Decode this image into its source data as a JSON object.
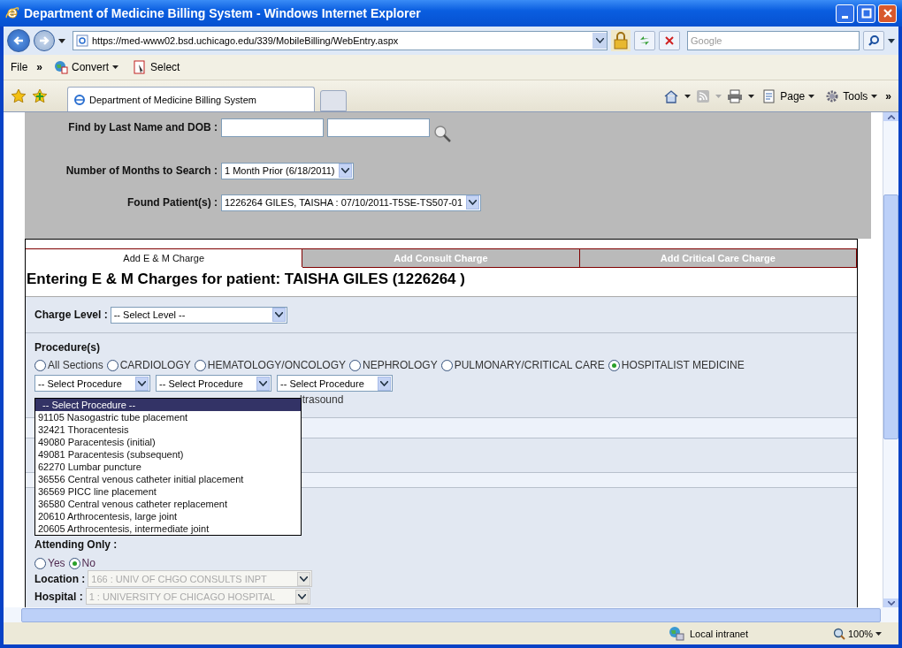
{
  "window": {
    "title": "Department of Medicine Billing System - Windows Internet Explorer"
  },
  "address_bar": {
    "url": "https://med-www02.bsd.uchicago.edu/339/MobileBilling/WebEntry.aspx",
    "search_placeholder": "Google"
  },
  "menu_bar": {
    "items": [
      "File"
    ],
    "overflow": "»",
    "commands": [
      {
        "label": "Convert",
        "kind": "convert"
      },
      {
        "label": "Select",
        "kind": "select"
      }
    ]
  },
  "tab_bar": {
    "tabs": [
      {
        "title": "Department of Medicine Billing System",
        "selected": true
      }
    ],
    "commands": [
      {
        "label": "Page",
        "kind": "page"
      },
      {
        "label": "Tools",
        "kind": "tools"
      }
    ]
  },
  "search_panel": {
    "find_label": "Find by Last Name and DOB :",
    "months_label": "Number of Months to Search :",
    "months_value": "1 Month Prior (6/18/2011)",
    "patient_label": "Found Patient(s) :",
    "patient_value": "1226264 GILES, TAISHA : 07/10/2011-T5SE-TS507-01"
  },
  "charge_tabs": [
    {
      "label": "Add E & M Charge",
      "selected": true
    },
    {
      "label": "Add Consult Charge",
      "selected": false
    },
    {
      "label": "Add Critical Care Charge",
      "selected": false
    }
  ],
  "heading": "Entering E & M Charges for patient: TAISHA GILES (1226264 )",
  "charge_level": {
    "label": "Charge Level :",
    "value": "-- Select Level --"
  },
  "procedures": {
    "label": "Procedure(s)",
    "sections": [
      {
        "label": "All Sections",
        "selected": false
      },
      {
        "label": "CARDIOLOGY",
        "selected": false
      },
      {
        "label": "HEMATOLOGY/ONCOLOGY",
        "selected": false
      },
      {
        "label": "NEPHROLOGY",
        "selected": false
      },
      {
        "label": "PULMONARY/CRITICAL CARE",
        "selected": false
      },
      {
        "label": "HOSPITALIST MEDICINE",
        "selected": true
      }
    ],
    "selects": [
      "-- Select Procedure",
      "-- Select Procedure",
      "-- Select Procedure"
    ],
    "partial_text": "ltrasound",
    "dropdown_options": [
      {
        "label": "-- Select Procedure --",
        "selected": true
      },
      {
        "label": "91105 Nasogastric tube placement",
        "selected": false
      },
      {
        "label": "32421 Thoracentesis",
        "selected": false
      },
      {
        "label": "49080 Paracentesis (initial)",
        "selected": false
      },
      {
        "label": "49081 Paracentesis (subsequent)",
        "selected": false
      },
      {
        "label": "62270 Lumbar puncture",
        "selected": false
      },
      {
        "label": "36556 Central venous catheter initial placement",
        "selected": false
      },
      {
        "label": "36569 PICC line placement",
        "selected": false
      },
      {
        "label": "36580 Central venous catheter replacement",
        "selected": false
      },
      {
        "label": "20610 Arthrocentesis, large joint",
        "selected": false
      },
      {
        "label": "20605 Arthrocentesis, intermediate joint",
        "selected": false
      }
    ]
  },
  "attending": {
    "label": "Attending Only :",
    "options": [
      {
        "label": "Yes",
        "selected": false
      },
      {
        "label": "No",
        "selected": true
      }
    ]
  },
  "location": {
    "label": "Location :",
    "value": "166 : UNIV OF CHGO CONSULTS INPT",
    "disabled": true
  },
  "hospital": {
    "label": "Hospital :",
    "value": "1 : UNIVERSITY OF CHICAGO HOSPITAL",
    "disabled": true
  },
  "status_bar": {
    "zone": "Local intranet",
    "zoom": "100%"
  }
}
